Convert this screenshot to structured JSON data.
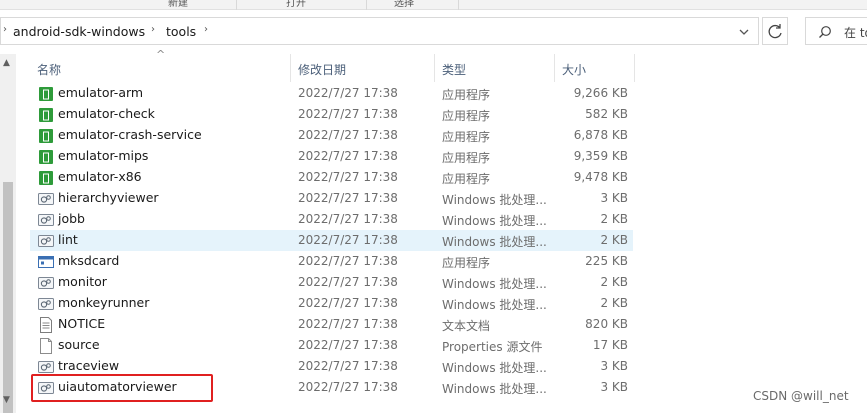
{
  "ribbon": {
    "labels": [
      "新建",
      "打开",
      "选择"
    ]
  },
  "address": {
    "crumbs": [
      "android-sdk-windows",
      "tools"
    ],
    "search_placeholder": "在 to"
  },
  "columns": {
    "name": "名称",
    "date": "修改日期",
    "type": "类型",
    "size": "大小"
  },
  "files": [
    {
      "name": "emulator-arm",
      "date": "2022/7/27 17:38",
      "type": "应用程序",
      "size": "9,266 KB",
      "icon": "exe-green-icon"
    },
    {
      "name": "emulator-check",
      "date": "2022/7/27 17:38",
      "type": "应用程序",
      "size": "582 KB",
      "icon": "exe-green-icon"
    },
    {
      "name": "emulator-crash-service",
      "date": "2022/7/27 17:38",
      "type": "应用程序",
      "size": "6,878 KB",
      "icon": "exe-green-icon"
    },
    {
      "name": "emulator-mips",
      "date": "2022/7/27 17:38",
      "type": "应用程序",
      "size": "9,359 KB",
      "icon": "exe-green-icon"
    },
    {
      "name": "emulator-x86",
      "date": "2022/7/27 17:38",
      "type": "应用程序",
      "size": "9,478 KB",
      "icon": "exe-green-icon"
    },
    {
      "name": "hierarchyviewer",
      "date": "2022/7/27 17:38",
      "type": "Windows 批处理...",
      "size": "3 KB",
      "icon": "batch-file-icon"
    },
    {
      "name": "jobb",
      "date": "2022/7/27 17:38",
      "type": "Windows 批处理...",
      "size": "2 KB",
      "icon": "batch-file-icon"
    },
    {
      "name": "lint",
      "date": "2022/7/27 17:38",
      "type": "Windows 批处理...",
      "size": "2 KB",
      "icon": "batch-file-icon",
      "selected": true
    },
    {
      "name": "mksdcard",
      "date": "2022/7/27 17:38",
      "type": "应用程序",
      "size": "225 KB",
      "icon": "exe-window-icon"
    },
    {
      "name": "monitor",
      "date": "2022/7/27 17:38",
      "type": "Windows 批处理...",
      "size": "2 KB",
      "icon": "batch-file-icon"
    },
    {
      "name": "monkeyrunner",
      "date": "2022/7/27 17:38",
      "type": "Windows 批处理...",
      "size": "2 KB",
      "icon": "batch-file-icon"
    },
    {
      "name": "NOTICE",
      "date": "2022/7/27 17:38",
      "type": "文本文档",
      "size": "820 KB",
      "icon": "text-file-icon"
    },
    {
      "name": "source",
      "date": "2022/7/27 17:38",
      "type": "Properties 源文件",
      "size": "17 KB",
      "icon": "blank-file-icon"
    },
    {
      "name": "traceview",
      "date": "2022/7/27 17:38",
      "type": "Windows 批处理...",
      "size": "3 KB",
      "icon": "batch-file-icon"
    },
    {
      "name": "uiautomatorviewer",
      "date": "2022/7/27 17:38",
      "type": "Windows 批处理...",
      "size": "3 KB",
      "icon": "batch-file-icon"
    }
  ],
  "watermark": "CSDN @will_net",
  "colors": {
    "selection": "#e5f3fb",
    "highlight": "#e02020",
    "exe_green": "#2e9b3a"
  }
}
